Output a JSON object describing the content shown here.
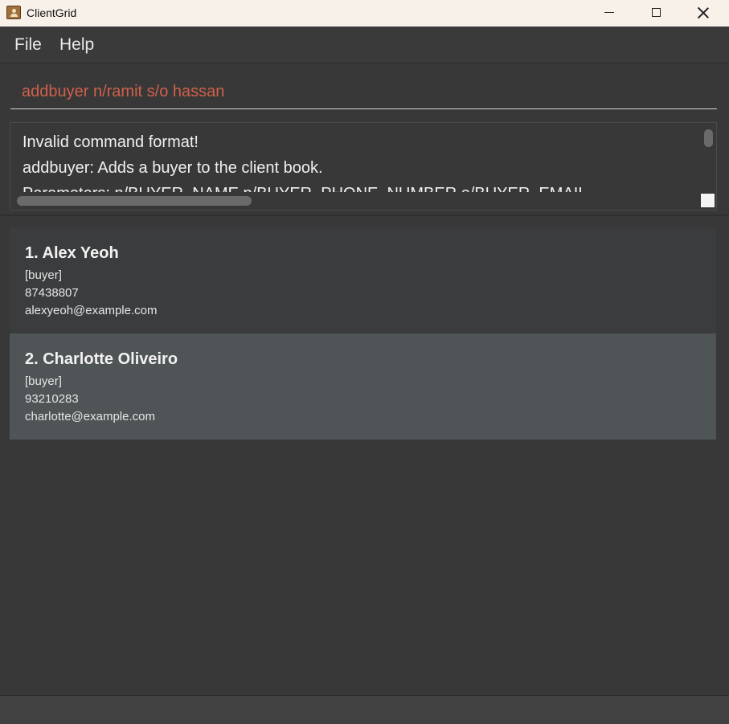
{
  "window": {
    "title": "ClientGrid",
    "app_icon": "contact-book-icon"
  },
  "menu": {
    "file_label": "File",
    "help_label": "Help"
  },
  "command": {
    "value": "addbuyer n/ramit s/o hassan"
  },
  "result": {
    "text": "Invalid command format!\naddbuyer: Adds a buyer to the client book.\nParameters: n/BUYER_NAME p/BUYER_PHONE_NUMBER e/BUYER_EMAIL"
  },
  "clients": [
    {
      "title": "1. Alex Yeoh",
      "tag": "[buyer]",
      "phone": "87438807",
      "email": "alexyeoh@example.com"
    },
    {
      "title": "2. Charlotte Oliveiro",
      "tag": "[buyer]",
      "phone": "93210283",
      "email": "charlotte@example.com"
    }
  ],
  "colors": {
    "background": "#383838",
    "command_text": "#d0604a",
    "selected_card": "#4f5457"
  }
}
